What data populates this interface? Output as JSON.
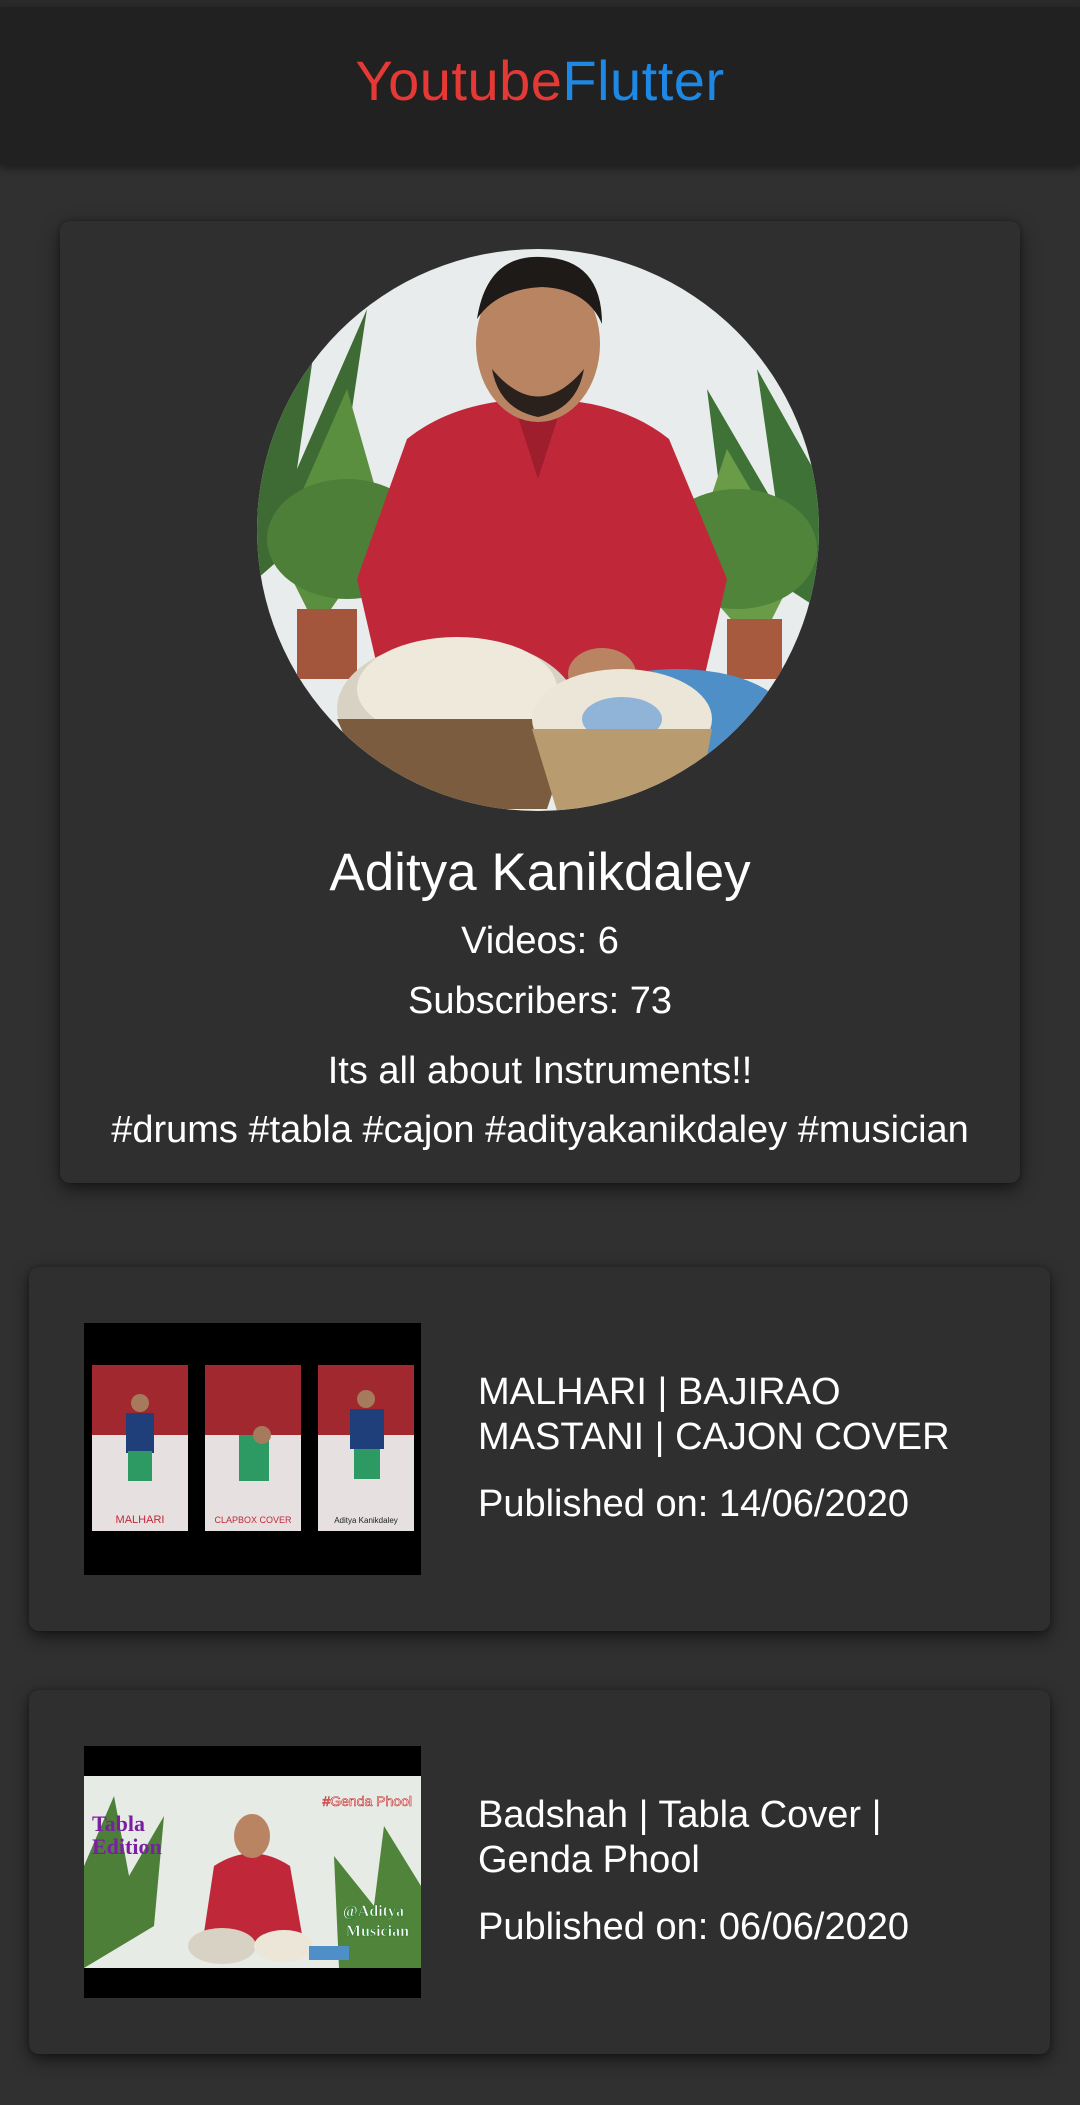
{
  "app_bar": {
    "title_part1": "Youtube",
    "title_part2": "Flutter",
    "title_color1": "#e53935",
    "title_color2": "#1e88e5"
  },
  "profile": {
    "name": "Aditya Kanikdaley",
    "videos": "Videos: 6",
    "subscribers": "Subscribers: 73",
    "description_line1": "Its all about Instruments!!",
    "description_line2": "#drums #tabla #cajon #adityakanikdaley #musician"
  },
  "videos": [
    {
      "title": "MALHARI | BAJIRAO MASTANI | CAJON COVER",
      "published": "Published on: 14/06/2020",
      "thumbnail_captions": [
        "MALHARI",
        "CLAPBOX COVER",
        "Aditya Kanikdaley"
      ]
    },
    {
      "title": "Badshah | Tabla Cover | Genda Phool",
      "published": "Published on: 06/06/2020",
      "thumbnail_captions": [
        "Tabla",
        "Edition",
        "#Genda Phool",
        "@Aditya",
        "Musician"
      ]
    }
  ],
  "colors": {
    "background": "#303030",
    "card": "#2f2f2f",
    "app_bar": "#212121",
    "text": "#ffffff"
  }
}
